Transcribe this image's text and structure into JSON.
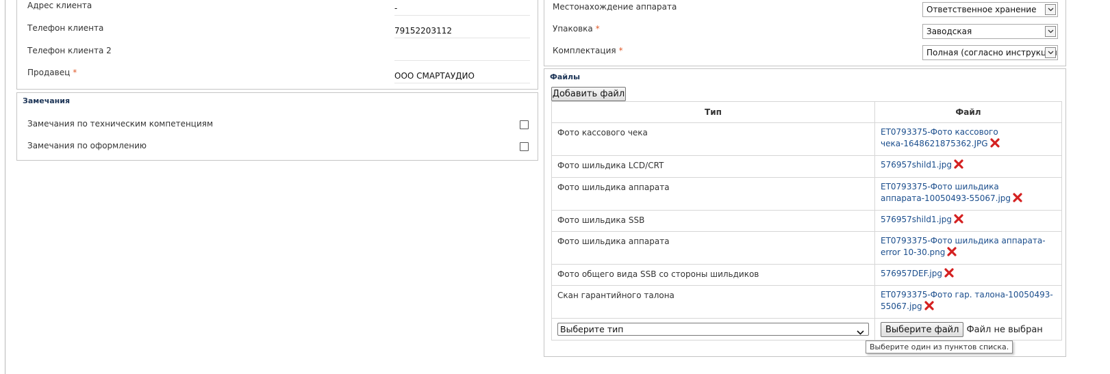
{
  "client": {
    "fields": [
      {
        "label": "Адрес клиента",
        "value": "-",
        "required": false
      },
      {
        "label": "Телефон клиента",
        "value": "79152203112",
        "required": false
      },
      {
        "label": "Телефон клиента 2",
        "value": "",
        "required": false
      },
      {
        "label": "Продавец",
        "value": "ООО СМАРТАУДИО",
        "required": true,
        "required_mark": "*"
      }
    ]
  },
  "remarks": {
    "title": "Замечания",
    "items": [
      {
        "label": "Замечания по техническим компетенциям",
        "checked": false
      },
      {
        "label": "Замечания по оформлению",
        "checked": false
      }
    ]
  },
  "device": {
    "fields": [
      {
        "label": "Местонахождение аппарата",
        "value": "Ответственное хранение",
        "required": false
      },
      {
        "label": "Упаковка",
        "value": "Заводская",
        "required": true,
        "required_mark": "*"
      },
      {
        "label": "Комплектация",
        "value": "Полная (согласно инструкции)",
        "required": true,
        "required_mark": "*"
      }
    ]
  },
  "files": {
    "title": "Файлы",
    "add_button": "Добавить файл",
    "columns": {
      "type": "Тип",
      "file": "Файл"
    },
    "rows": [
      {
        "type": "Фото кассового чека",
        "file": "ET0793375-Фото кассового чека-1648621875362.JPG"
      },
      {
        "type": "Фото шильдика LCD/CRT",
        "file": "576957shild1.jpg"
      },
      {
        "type": "Фото шильдика аппарата",
        "file": "ET0793375-Фото шильдика аппарата-10050493-55067.jpg"
      },
      {
        "type": "Фото шильдика SSB",
        "file": "576957shild1.jpg"
      },
      {
        "type": "Фото шильдика аппарата",
        "file": "ET0793375-Фото шильдика аппарата-error 10-30.png"
      },
      {
        "type": "Фото общего вида SSB со стороны шильдиков",
        "file": "576957DEF.jpg"
      },
      {
        "type": "Скан гарантийного талона",
        "file": "ET0793375-Фото гар. талона-10050493-55067.jpg"
      }
    ],
    "new_row": {
      "type_placeholder": "Выберите тип",
      "choose_button": "Выберите файл",
      "no_file_text": "Файл не выбран"
    },
    "tooltip": "Выберите один из пунктов списка."
  },
  "colors": {
    "link": "#1a4d8c",
    "required": "#e05a2a",
    "delete": "#d42020",
    "title": "#1d3557"
  },
  "icons": {
    "delete": "red-x-delete-icon",
    "dropdown": "chevron-down-icon"
  }
}
